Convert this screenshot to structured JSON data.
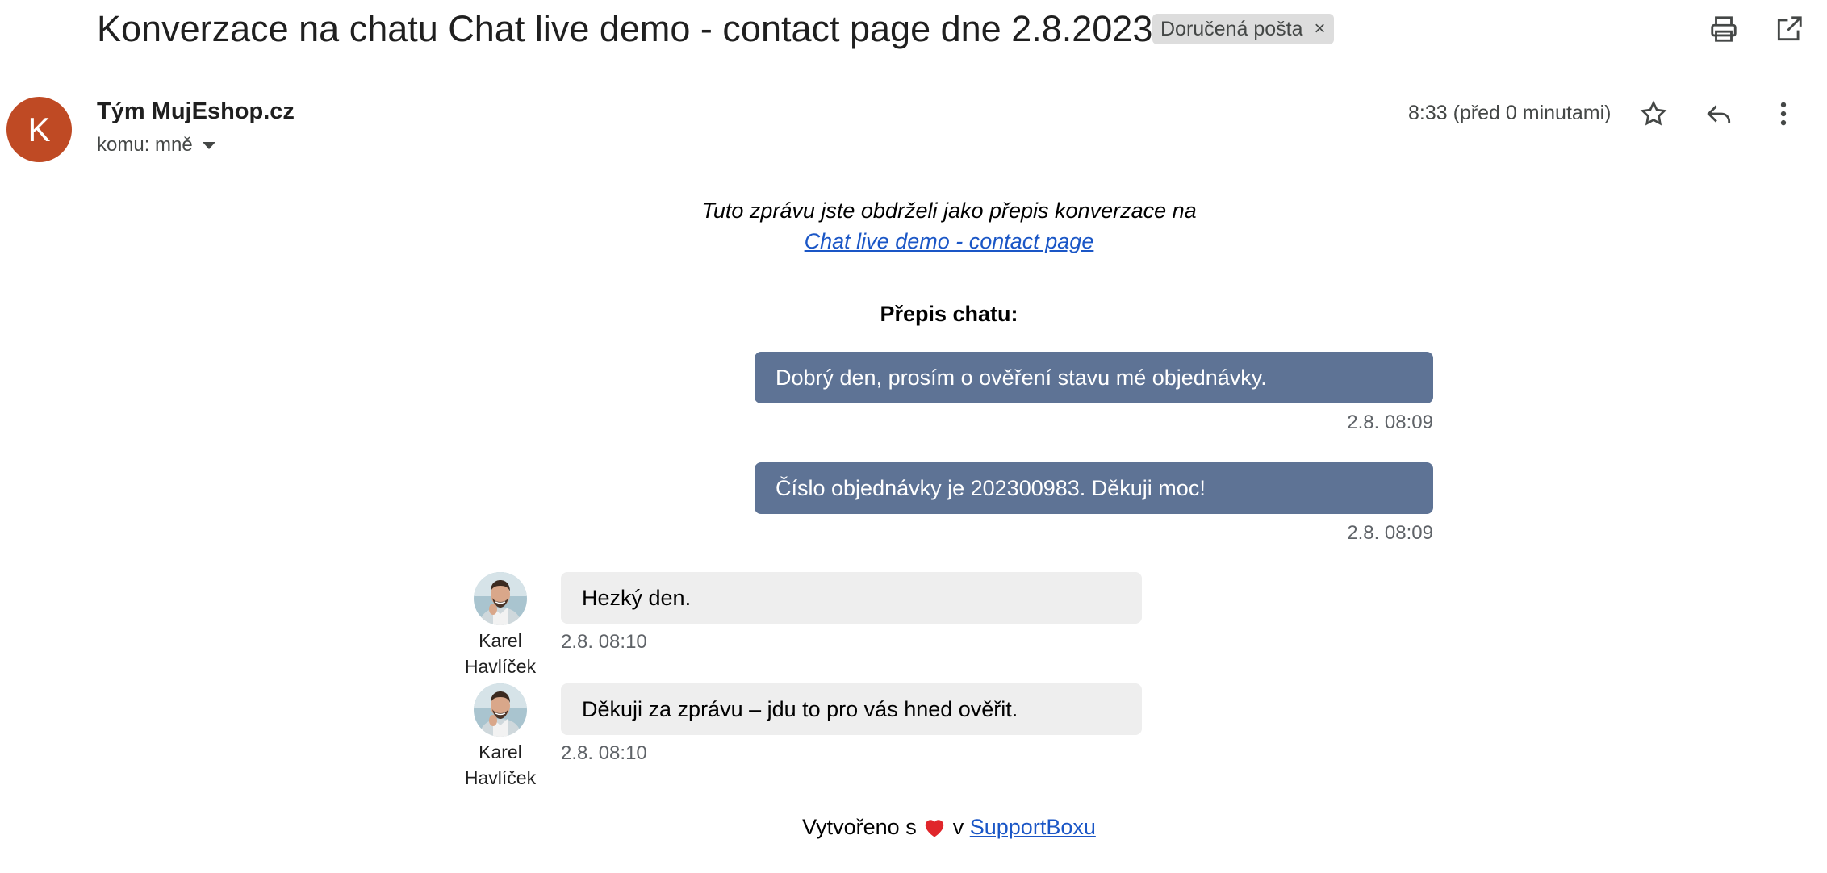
{
  "header": {
    "subject": "Konverzace na chatu Chat live demo - contact page dne 2.8.2023",
    "label": "Doručená pošta",
    "label_remove": "×"
  },
  "sender": {
    "avatar_letter": "K",
    "name": "Tým MujEshop.cz",
    "recipient": "komu: mně",
    "timestamp": "8:33 (před 0 minutami)"
  },
  "body": {
    "intro": "Tuto zprávu jste obdrželi jako přepis konverzace na",
    "link": "Chat live demo - contact page",
    "chat_heading": "Přepis chatu:",
    "messages": [
      {
        "text": "Dobrý den, prosím o ověření stavu mé objednávky.",
        "time": "2.8. 08:09"
      },
      {
        "text": "Číslo objednávky je 202300983. Děkuji moc!",
        "time": "2.8. 08:09"
      },
      {
        "agent_first": "Karel",
        "agent_last": "Havlíček",
        "text": "Hezký den.",
        "time": "2.8. 08:10"
      },
      {
        "agent_first": "Karel",
        "agent_last": "Havlíček",
        "text": "Děkuji za zprávu – jdu to pro vás hned ověřit.",
        "time": "2.8. 08:10"
      }
    ],
    "footer_prefix": "Vytvořeno s",
    "footer_mid": "v",
    "footer_link": "SupportBoxu"
  },
  "colors": {
    "avatar_bg": "#bf4a24",
    "outgoing_bubble": "#5e7395",
    "incoming_bubble": "#eeeeee",
    "link": "#1a56c6",
    "heart": "#e0262b"
  }
}
